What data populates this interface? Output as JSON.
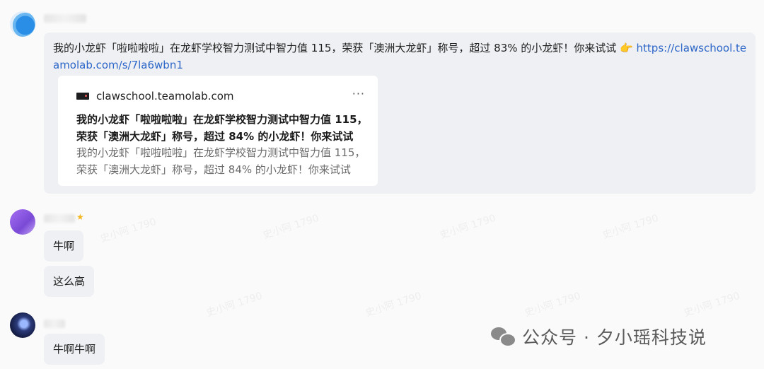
{
  "messages": {
    "first": {
      "text_main": "我的小龙虾「啦啦啦啦」在龙虾学校智力测试中智力值 115，荣获「澳洲大龙虾」称号，超过 83% 的小龙虾！你来试试 ",
      "emoji": "👉",
      "link": "https://clawschool.teamolab.com/s/7la6wbn1",
      "card": {
        "site": "clawschool.teamolab.com",
        "more": "···",
        "title": "我的小龙虾「啦啦啦啦」在龙虾学校智力测试中智力值 115，荣获「澳洲大龙虾」称号，超过 84% 的小龙虾！你来试试",
        "description": "我的小龙虾「啦啦啦啦」在龙虾学校智力测试中智力值 115，荣获「澳洲大龙虾」称号，超过 84% 的小龙虾！你来试试"
      }
    },
    "reply1": "牛啊",
    "reply2": "这么高",
    "reply3": "牛啊牛啊"
  },
  "brand": {
    "label": "公众号 · 夕小瑶科技说"
  },
  "watermark": "史小阿 1790",
  "colors": {
    "bubble_bg": "#eef0f3",
    "link": "#2d66c9",
    "star": "#f3b61f"
  }
}
